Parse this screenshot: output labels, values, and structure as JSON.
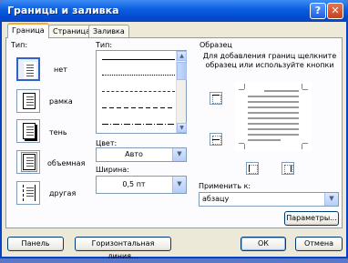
{
  "window": {
    "title": "Границы и заливка"
  },
  "tabs": [
    {
      "label": "Граница",
      "active": true
    },
    {
      "label": "Страница",
      "active": false
    },
    {
      "label": "Заливка",
      "active": false
    }
  ],
  "type_section": {
    "label": "Тип:",
    "settings": [
      {
        "label": "нет",
        "icon": "border-none-icon",
        "selected": true
      },
      {
        "label": "рамка",
        "icon": "border-box-icon",
        "selected": false
      },
      {
        "label": "тень",
        "icon": "border-shadow-icon",
        "selected": false
      },
      {
        "label": "объемная",
        "icon": "border-3d-icon",
        "selected": false
      },
      {
        "label": "другая",
        "icon": "border-custom-icon",
        "selected": false
      }
    ]
  },
  "style_section": {
    "label": "Тип:",
    "line_styles": [
      "solid",
      "dotted",
      "dashed-small",
      "dashed",
      "dash-dot"
    ],
    "color_label": "Цвет:",
    "color_value": "Авто",
    "width_label": "Ширина:",
    "width_value": "0,5 пт"
  },
  "preview": {
    "group_label": "Образец",
    "hint": "Для добавления границ щелкните образец или используйте кнопки"
  },
  "apply_to": {
    "label": "Применить к:",
    "value": "абзацу"
  },
  "buttons": {
    "parameters": "Параметры...",
    "panel": "Панель",
    "horizontal_line": "Горизонтальная линия...",
    "ok": "ОК",
    "cancel": "Отмена"
  },
  "colors": {
    "title_bar": "#0a5de0",
    "dialog_bg": "#ece9d8",
    "active_tab_accent": "#f7a935"
  }
}
